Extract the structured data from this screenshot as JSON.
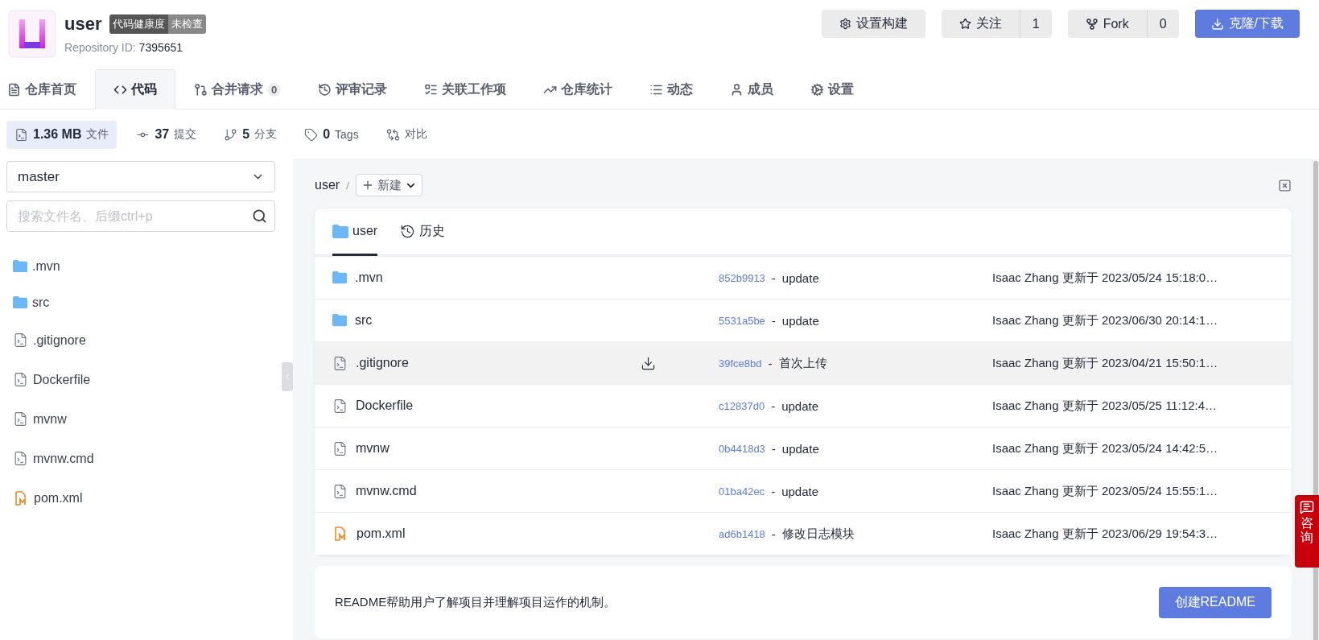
{
  "repo": {
    "name": "user",
    "health_label": "代码健康度",
    "health_value": "未检查",
    "id_label": "Repository ID:",
    "id": "7395651"
  },
  "actions": {
    "build": "设置构建",
    "star": {
      "label": "关注",
      "count": "1"
    },
    "fork": {
      "label": "Fork",
      "count": "0"
    },
    "clone": "克隆/下载"
  },
  "nav_tabs": [
    {
      "kind": "home",
      "label": "仓库首页",
      "selected": false
    },
    {
      "kind": "code",
      "label": "代码",
      "selected": true
    },
    {
      "kind": "merge",
      "label": "合并请求",
      "count": "0",
      "selected": false
    },
    {
      "kind": "review",
      "label": "评审记录",
      "selected": false
    },
    {
      "kind": "work",
      "label": "关联工作项",
      "selected": false
    },
    {
      "kind": "stats",
      "label": "仓库统计",
      "selected": false
    },
    {
      "kind": "activity",
      "label": "动态",
      "selected": false
    },
    {
      "kind": "members",
      "label": "成员",
      "selected": false
    },
    {
      "kind": "settings",
      "label": "设置",
      "selected": false
    }
  ],
  "stats": [
    {
      "kind": "size",
      "value": "1.36 MB",
      "label": "文件",
      "selected": true
    },
    {
      "kind": "commits",
      "value": "37",
      "label": "提交",
      "selected": false
    },
    {
      "kind": "branches",
      "value": "5",
      "label": "分支",
      "selected": false
    },
    {
      "kind": "tags",
      "value": "0",
      "label": "Tags",
      "selected": false
    },
    {
      "kind": "compare",
      "label": "对比",
      "selected": false
    }
  ],
  "sidebar": {
    "branch": "master",
    "search": {
      "placeholder": "搜索文件名、后缀ctrl+p"
    },
    "items": [
      {
        "kind": "folder",
        "name": ".mvn"
      },
      {
        "kind": "folder",
        "name": "src"
      },
      {
        "kind": "file",
        "name": ".gitignore"
      },
      {
        "kind": "file",
        "name": "Dockerfile"
      },
      {
        "kind": "file",
        "name": "mvnw"
      },
      {
        "kind": "file",
        "name": "mvnw.cmd"
      },
      {
        "kind": "maven",
        "name": "pom.xml"
      }
    ]
  },
  "breadcrumb": {
    "path": "user",
    "separator": "/",
    "new_button": "新建"
  },
  "file_card": {
    "tabs": [
      {
        "kind": "folder",
        "label": "user",
        "selected": true
      },
      {
        "kind": "history",
        "label": "历史",
        "selected": false
      }
    ],
    "rows": [
      {
        "kind": "folder",
        "name": ".mvn",
        "hash": "852b9913",
        "separator": "-",
        "message": "update",
        "updated": "Isaac Zhang 更新于 2023/05/24 15:18:0…",
        "hovered": false
      },
      {
        "kind": "folder",
        "name": "src",
        "hash": "5531a5be",
        "separator": "-",
        "message": "update",
        "updated": "Isaac Zhang 更新于 2023/06/30 20:14:1…",
        "hovered": false
      },
      {
        "kind": "file",
        "name": ".gitignore",
        "hash": "39fce8bd",
        "separator": "-",
        "message": "首次上传",
        "updated": "Isaac Zhang 更新于 2023/04/21 15:50:1…",
        "hovered": true
      },
      {
        "kind": "file",
        "name": "Dockerfile",
        "hash": "c12837d0",
        "separator": "-",
        "message": "update",
        "updated": "Isaac Zhang 更新于 2023/05/25 11:12:4…",
        "hovered": false
      },
      {
        "kind": "file",
        "name": "mvnw",
        "hash": "0b4418d3",
        "separator": "-",
        "message": "update",
        "updated": "Isaac Zhang 更新于 2023/05/24 14:42:5…",
        "hovered": false
      },
      {
        "kind": "file",
        "name": "mvnw.cmd",
        "hash": "01ba42ec",
        "separator": "-",
        "message": "update",
        "updated": "Isaac Zhang 更新于 2023/05/24 15:55:1…",
        "hovered": false
      },
      {
        "kind": "maven",
        "name": "pom.xml",
        "hash": "ad6b1418",
        "separator": "-",
        "message": "修改日志模块",
        "updated": "Isaac Zhang 更新于 2023/06/29 19:54:3…",
        "hovered": false
      }
    ]
  },
  "readme": {
    "text": "README帮助用户了解项目并理解项目运作的机制。",
    "button": "创建README"
  },
  "consult": "咨询"
}
